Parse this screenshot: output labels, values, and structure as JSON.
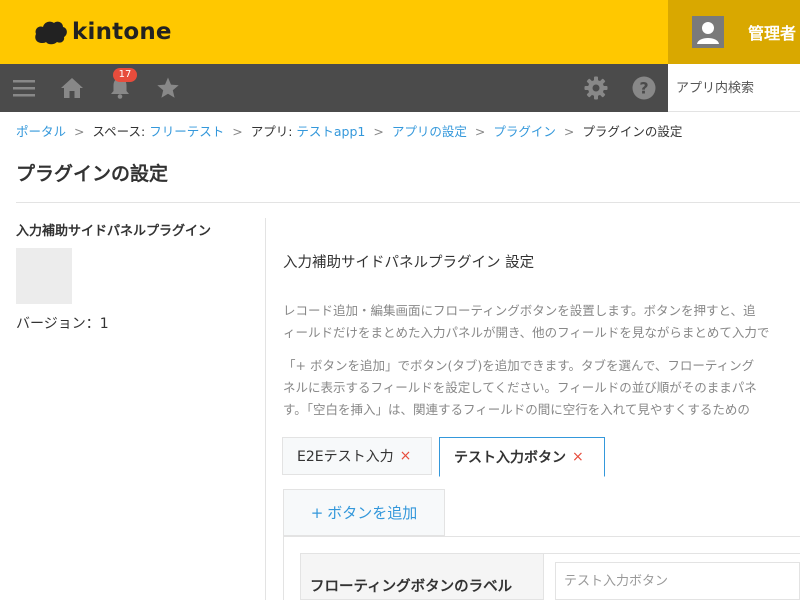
{
  "header": {
    "logo_text": "kintone",
    "user_name": "管理者",
    "brand_color": "#ffc800"
  },
  "toolbar": {
    "icons": [
      "menu-icon",
      "home-icon",
      "bell-icon",
      "star-icon",
      "gear-icon",
      "help-icon"
    ],
    "notification_count": "17",
    "search_placeholder": "アプリ内検索"
  },
  "breadcrumb": {
    "portal": "ポータル",
    "space_prefix": "スペース: ",
    "space": "フリーテスト",
    "app_prefix": "アプリ: ",
    "app": "テストapp1",
    "app_settings": "アプリの設定",
    "plugins": "プラグイン",
    "current": "プラグインの設定",
    "separator": ">"
  },
  "page": {
    "title": "プラグインの設定"
  },
  "plugin": {
    "name": "入力補助サイドパネルプラグイン",
    "version": "バージョン：1"
  },
  "settings": {
    "title": "入力補助サイドパネルプラグイン 設定",
    "desc1_line1": "レコード追加・編集画面にフローティングボタンを設置します。ボタンを押すと、追",
    "desc1_line2": "ィールドだけをまとめた入力パネルが開き、他のフィールドを見ながらまとめて入力で",
    "desc2_line1": "「+ ボタンを追加」でボタン(タブ)を追加できます。タブを選んで、フローティング",
    "desc2_line2": "ネルに表示するフィールドを設定してください。フィールドの並び順がそのままパネ",
    "desc2_line3": "す。「空白を挿入」は、関連するフィールドの間に空行を入れて見やすくするための"
  },
  "tabs": [
    {
      "label": "E2Eテスト入力",
      "close": "×"
    },
    {
      "label": "テスト入力ボタン",
      "close": "×"
    }
  ],
  "add_button": {
    "plus": "+",
    "label": "ボタンを追加"
  },
  "form": {
    "label_field_label": "フローティングボタンのラベル",
    "label_field_placeholder": "テスト入力ボタン"
  }
}
